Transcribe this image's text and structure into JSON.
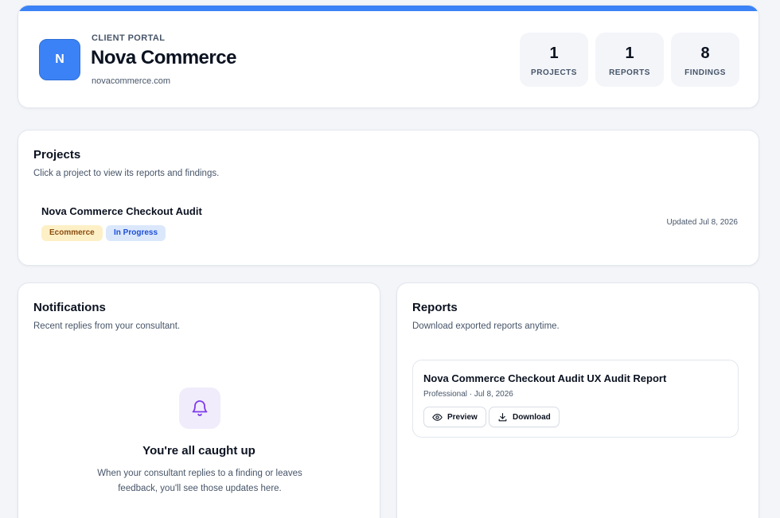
{
  "header": {
    "logo_letter": "N",
    "eyebrow": "CLIENT PORTAL",
    "client_name": "Nova Commerce",
    "domain": "novacommerce.com",
    "accent_color": "#3b82f6",
    "stats": [
      {
        "value": "1",
        "label": "PROJECTS"
      },
      {
        "value": "1",
        "label": "REPORTS"
      },
      {
        "value": "8",
        "label": "FINDINGS"
      }
    ]
  },
  "projects": {
    "title": "Projects",
    "subtitle": "Click a project to view its reports and findings.",
    "items": [
      {
        "name": "Nova Commerce Checkout Audit",
        "category": "Ecommerce",
        "status": "In Progress",
        "updated": "Updated Jul 8, 2026"
      }
    ]
  },
  "notifications": {
    "title": "Notifications",
    "subtitle": "Recent replies from your consultant.",
    "empty_icon": "bell-icon",
    "empty_title": "You're all caught up",
    "empty_text": "When your consultant replies to a finding or leaves feedback, you'll see those updates here."
  },
  "reports": {
    "title": "Reports",
    "subtitle": "Download exported reports anytime.",
    "items": [
      {
        "title": "Nova Commerce Checkout Audit UX Audit Report",
        "meta": "Professional · Jul 8, 2026",
        "preview_label": "Preview",
        "preview_icon": "eye-icon",
        "download_label": "Download",
        "download_icon": "download-icon"
      }
    ]
  }
}
